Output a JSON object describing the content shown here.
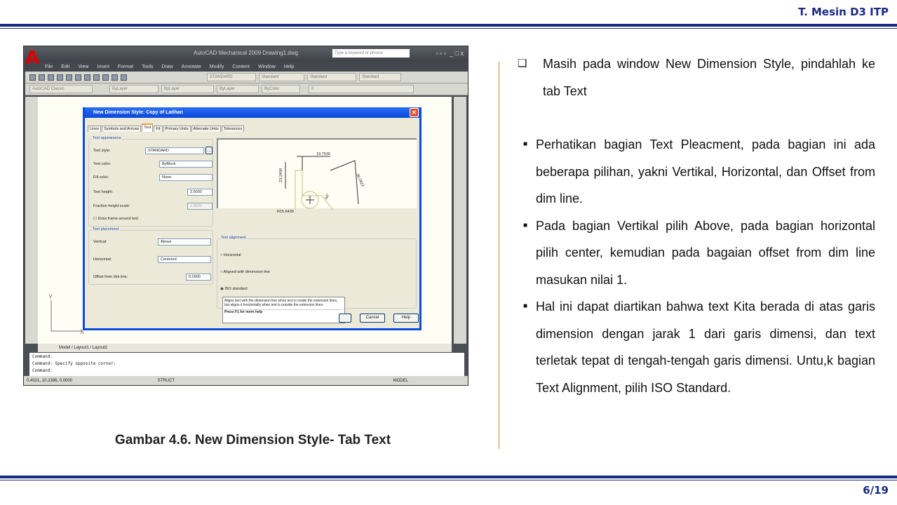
{
  "header": {
    "institution": "T. Mesin D3 ITP"
  },
  "footer": {
    "page": "6/19"
  },
  "figure": {
    "caption": "Gambar 4.6. New Dimension Style- Tab Text"
  },
  "autocad": {
    "title": "AutoCAD Mechanical 2009 Drawing1.dwg",
    "search_placeholder": "Type a keyword or phrase",
    "menu": [
      "File",
      "Edit",
      "View",
      "Insert",
      "Format",
      "Tools",
      "Draw",
      "Annotate",
      "Modify",
      "Content",
      "Window",
      "Help"
    ],
    "styles": [
      "STANDARD",
      "Standard",
      "Standard",
      "Standard"
    ],
    "workspace": "AutoCAD Classic",
    "layer_props": [
      "ByLayer",
      "ByLayer",
      "ByLayer",
      "ByColor"
    ],
    "layer": "0",
    "layout_tabs": [
      "Model",
      "Layout1",
      "Layout2"
    ],
    "command_lines": [
      "Command:",
      "Command: Specify opposite corner:",
      "Command:"
    ],
    "coords": "0.4021, 10.2386, 0.0000",
    "status_struct": "STRUCT",
    "status_model": "MODEL",
    "axis_y": "Y",
    "axis_x": "X"
  },
  "dialog": {
    "title": "New Dimension Style: Copy of Latihan",
    "tabs": [
      "Lines",
      "Symbols and Arrows",
      "Text",
      "Fit",
      "Primary Units",
      "Alternate Units",
      "Tolerances"
    ],
    "active_tab": "Text",
    "text_appearance": {
      "label": "Text appearance",
      "text_style_label": "Text style:",
      "text_style": "STANDARD",
      "text_color_label": "Text color:",
      "text_color": "ByBlock",
      "fill_color_label": "Fill color:",
      "fill_color": "None",
      "text_height_label": "Text height:",
      "text_height": "3.5000",
      "fraction_label": "Fraction height scale:",
      "fraction": "1.0000",
      "frame_label": "Draw frame around text"
    },
    "text_placement": {
      "label": "Text placement",
      "vertical_label": "Vertical:",
      "vertical": "Above",
      "horizontal_label": "Horizontal:",
      "horizontal": "Centered",
      "offset_label": "Offset from dim line:",
      "offset": "0.0900"
    },
    "text_alignment": {
      "label": "Text alignment",
      "options": [
        "Horizontal",
        "Aligned with dimension line",
        "ISO standard"
      ],
      "selected": "ISO standard"
    },
    "preview_dims": [
      "19.7536",
      "23.2458",
      "39.2923",
      "60°",
      "R15.6439"
    ],
    "tooltip": "Aligns text with the dimension line when text is inside the extension lines, but aligns it horizontally when text is outside the extension lines.",
    "tooltip_help": "Press F1 for more help",
    "buttons": {
      "cancel": "Cancel",
      "help": "Help"
    }
  },
  "content": {
    "main": "Masih pada window New Dimension Style, pindahlah ke tab Text",
    "points": [
      "Perhatikan bagian Text Pleacment, pada bagian ini ada beberapa pilihan, yakni Vertikal, Horizontal, dan Offset from dim line.",
      "Pada bagian Vertikal pilih Above, pada bagian horizontal pilih center, kemudian pada bagaian offset from dim line masukan nilai 1.",
      "Hal ini dapat diartikan bahwa text Kita berada di atas garis dimension dengan jarak 1 dari garis dimensi, dan text terletak tepat di tengah-tengah garis dimensi. Untu,k bagian Text Alignment, pilih ISO Standard."
    ]
  },
  "colors": {
    "brand_navy": "#1a2a80",
    "divider": "#c8802a",
    "dialog_blue": "#0a4be0"
  }
}
